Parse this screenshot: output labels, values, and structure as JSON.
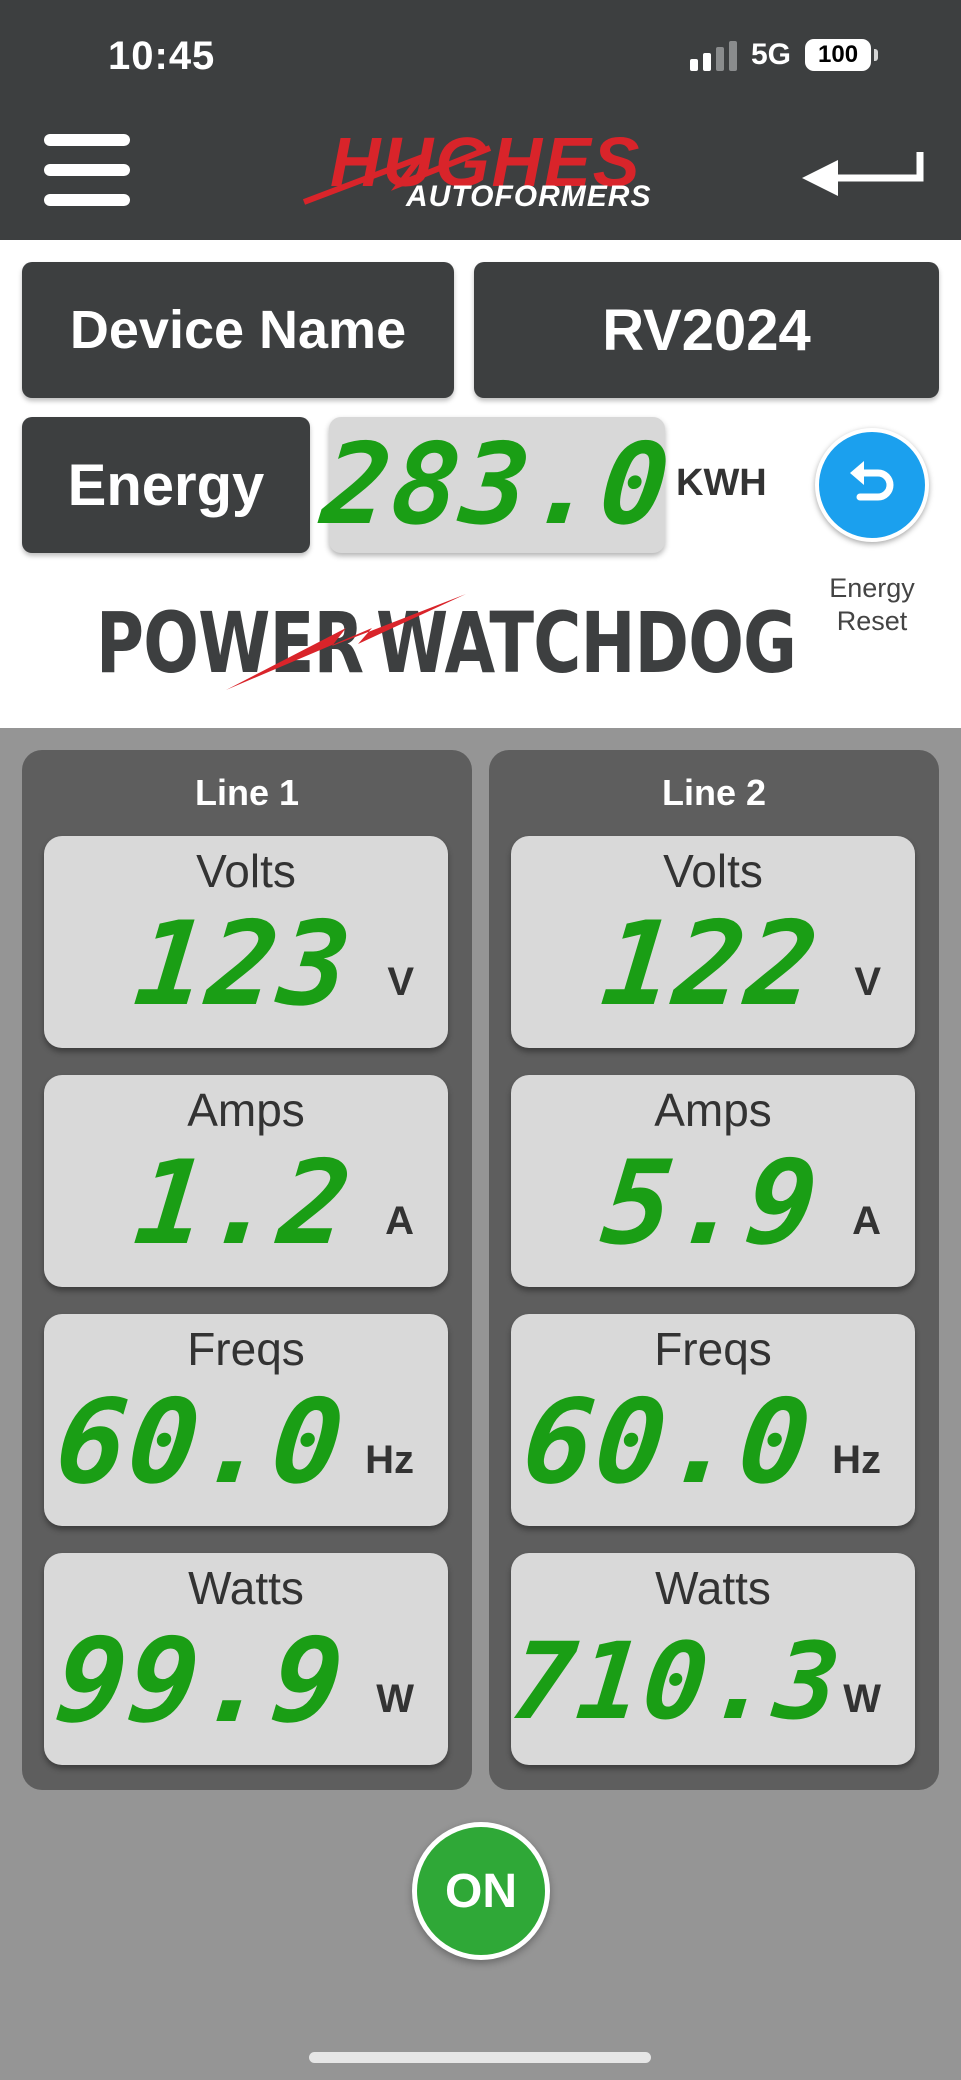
{
  "status_bar": {
    "time": "10:45",
    "network": "5G",
    "battery": "100"
  },
  "header": {
    "logo_main": "HUGHES",
    "logo_sub": "AUTOFORMERS",
    "logo_color": "#d9242a",
    "menu_icon": "hamburger-icon",
    "back_icon": "back-arrow-icon"
  },
  "device": {
    "name_label": "Device Name",
    "name_value": "RV2024",
    "energy_label": "Energy",
    "energy_value": "283.0",
    "energy_unit": "KWH",
    "reset_label_1": "Energy",
    "reset_label_2": "Reset",
    "reset_icon": "undo-icon",
    "brand_left": "POWER",
    "brand_right": "WATCHDOG"
  },
  "lines": [
    {
      "title": "Line 1",
      "readings": [
        {
          "label": "Volts",
          "value": "123",
          "unit": "V"
        },
        {
          "label": "Amps",
          "value": "1.2",
          "unit": "A"
        },
        {
          "label": "Freqs",
          "value": "60.0",
          "unit": "Hz"
        },
        {
          "label": "Watts",
          "value": "99.9",
          "unit": "W"
        }
      ]
    },
    {
      "title": "Line 2",
      "readings": [
        {
          "label": "Volts",
          "value": "122",
          "unit": "V"
        },
        {
          "label": "Amps",
          "value": "5.9",
          "unit": "A"
        },
        {
          "label": "Freqs",
          "value": "60.0",
          "unit": "Hz"
        },
        {
          "label": "Watts",
          "value": "710.3",
          "unit": "W"
        }
      ]
    }
  ],
  "power_button": {
    "label": "ON",
    "color": "#2fa837"
  },
  "colors": {
    "header_bg": "#3d3f40",
    "lcd_green": "#1a9e15",
    "reset_blue": "#1ba0ee"
  }
}
